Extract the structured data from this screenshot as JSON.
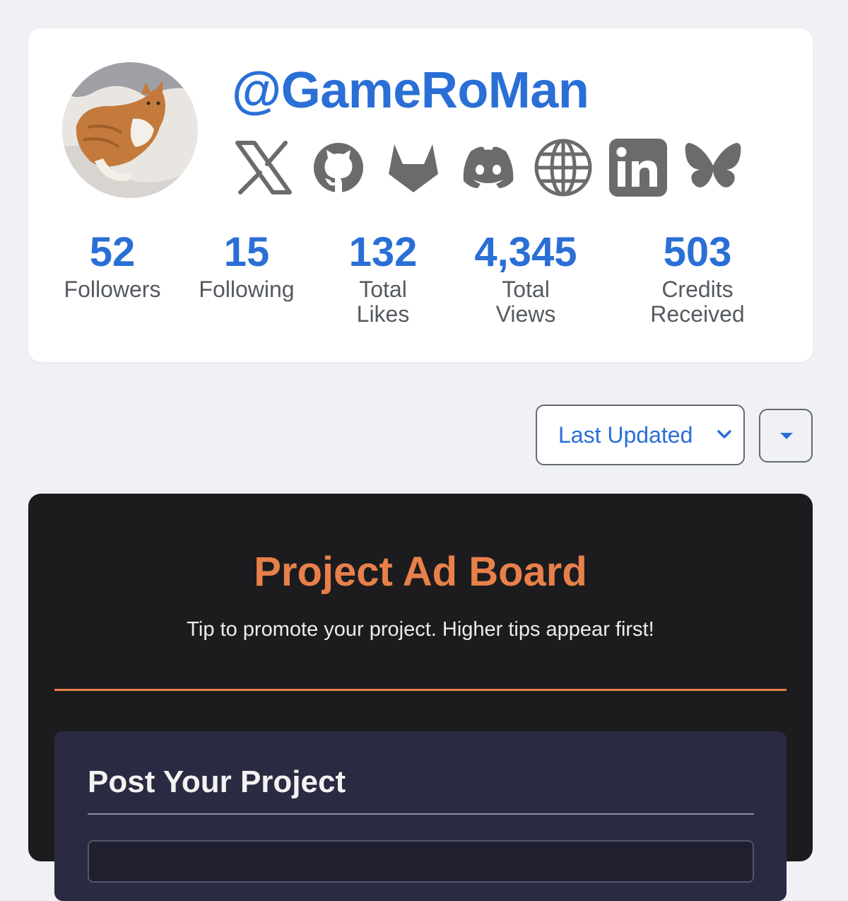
{
  "profile": {
    "username": "@GameRoMan",
    "avatar_alt": "avatar",
    "socials": [
      {
        "icon": "x-icon"
      },
      {
        "icon": "github-icon"
      },
      {
        "icon": "gitlab-icon"
      },
      {
        "icon": "discord-icon"
      },
      {
        "icon": "globe-icon"
      },
      {
        "icon": "linkedin-icon"
      },
      {
        "icon": "bluesky-icon"
      }
    ],
    "stats": [
      {
        "value": "52",
        "label": "Followers"
      },
      {
        "value": "15",
        "label": "Following"
      },
      {
        "value": "132",
        "label_line1": "Total",
        "label_line2": "Likes"
      },
      {
        "value": "4,345",
        "label_line1": "Total",
        "label_line2": "Views"
      },
      {
        "value": "503",
        "label_line1": "Credits",
        "label_line2": "Received"
      }
    ]
  },
  "sort": {
    "selected": "Last Updated",
    "order_icon": "caret-down-icon"
  },
  "ad_board": {
    "title": "Project Ad Board",
    "subtitle": "Tip to promote your project. Higher tips appear first!",
    "post_panel": {
      "title": "Post Your Project"
    }
  },
  "colors": {
    "accent": "#2a6fd6",
    "ad_accent": "#e8804a",
    "icon_gray": "#6b6b6b",
    "page_bg": "#eff1f5",
    "board_bg": "#1c1c1f",
    "panel_bg": "#2a2a42"
  }
}
